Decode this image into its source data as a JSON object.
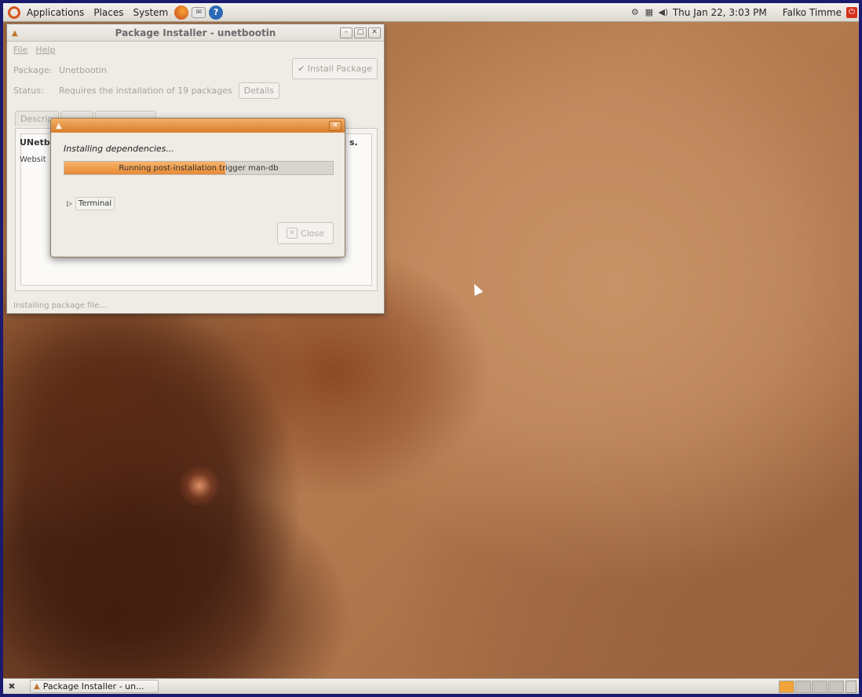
{
  "top_panel": {
    "menus": [
      "Applications",
      "Places",
      "System"
    ],
    "clock": "Thu Jan 22,  3:03 PM",
    "user": "Falko Timme"
  },
  "installer_window": {
    "title": "Package Installer - unetbootin",
    "menu": [
      "File",
      "Help"
    ],
    "package_label": "Package:",
    "package_value": "Unetbootin",
    "status_label": "Status:",
    "status_value": "Requires the installation of 19 packages",
    "details_button": "Details",
    "install_button": "Install Package",
    "tabs": [
      "Descrip",
      "",
      ""
    ],
    "description_heading": "UNetb",
    "description_heading_tail": "s.",
    "website_label": "Websit",
    "statusbar": "Installing package file..."
  },
  "progress_dialog": {
    "message": "Installing dependencies...",
    "progress_text": "Running post-installation trigger man-db",
    "progress_fraction": 0.6,
    "terminal_label": "Terminal",
    "close_button": "Close"
  },
  "bottom_panel": {
    "task_label": "Package Installer - un...",
    "workspaces": 4,
    "active_workspace": 1
  }
}
